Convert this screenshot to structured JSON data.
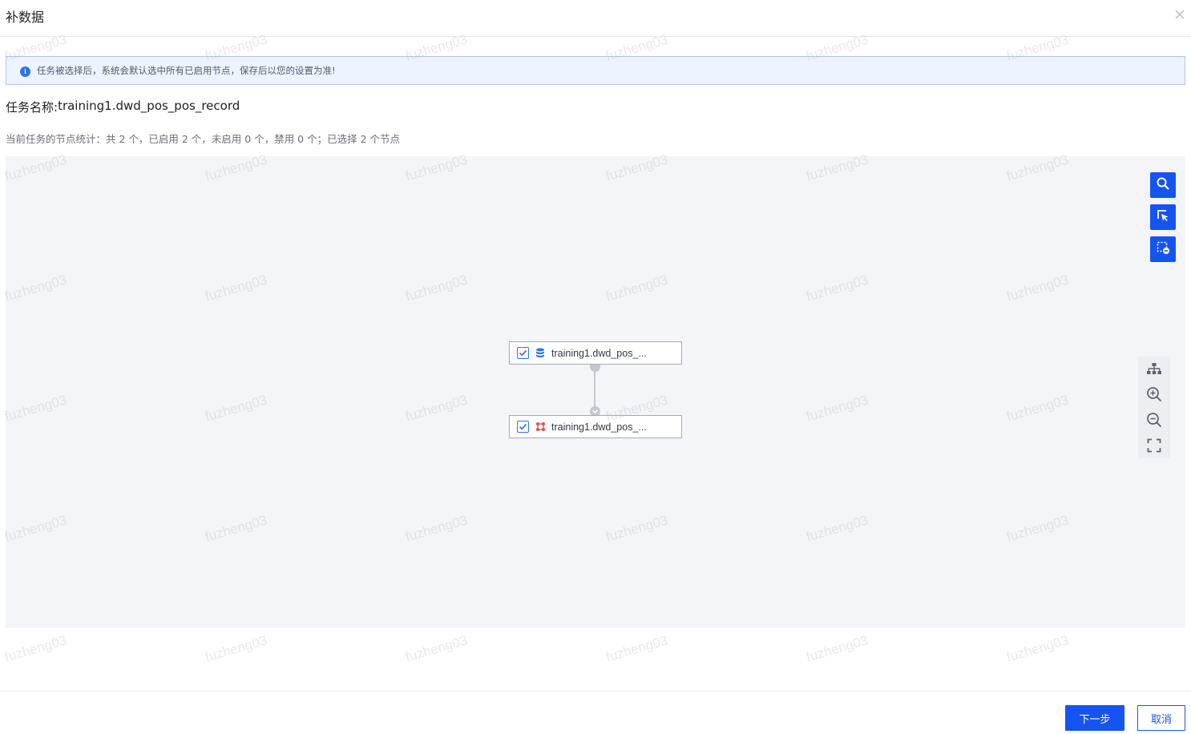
{
  "dialog": {
    "title": "补数据",
    "close_icon": "close-icon"
  },
  "alert": {
    "icon": "info-icon",
    "text": "任务被选择后，系统会默认选中所有已启用节点，保存后以您的设置为准!"
  },
  "task": {
    "label": "任务名称:",
    "name": "training1.dwd_pos_pos_record"
  },
  "stats": {
    "text": "当前任务的节点统计：共 2 个，已启用 2 个，未启用 0 个，禁用 0 个；已选择 2 个节点"
  },
  "toolbar": {
    "search_icon": "search-icon",
    "select_icon": "pointer-select-icon",
    "deselect_icon": "box-deselect-icon"
  },
  "graph": {
    "nodes": [
      {
        "label": "training1.dwd_pos_...",
        "checked": true,
        "icon": "database-icon"
      },
      {
        "label": "training1.dwd_pos_...",
        "checked": true,
        "icon": "transform-icon"
      }
    ]
  },
  "controls": {
    "layout_icon": "hierarchy-layout-icon",
    "zoom_in_icon": "zoom-in-icon",
    "zoom_out_icon": "zoom-out-icon",
    "fit_icon": "fit-screen-icon"
  },
  "footer": {
    "next_label": "下一步",
    "cancel_label": "取消"
  },
  "watermark": {
    "text": "fuzheng03"
  },
  "colors": {
    "primary": "#1654f2",
    "alert_bg": "#eef4ff",
    "alert_border": "#a9c4f5",
    "canvas_bg": "#f4f5f8",
    "transform_icon": "#e5484d"
  }
}
